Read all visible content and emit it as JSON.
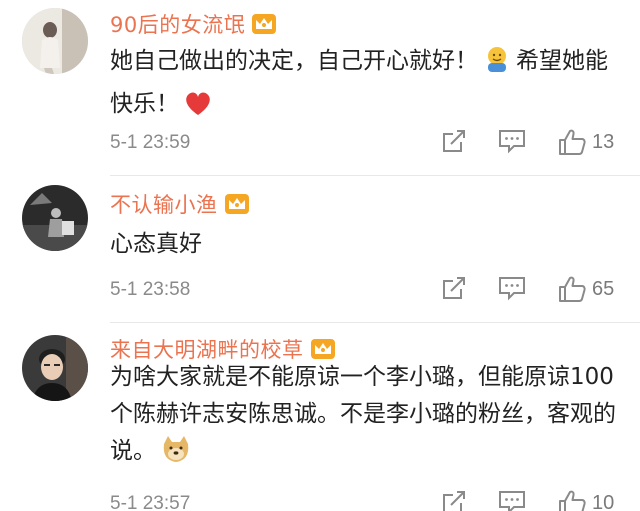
{
  "comments": [
    {
      "username": "90后的女流氓",
      "text_part1": "她自己做出的决定，自己开心就好！",
      "text_part2": "希望她能快乐！",
      "time": "5-1 23:59",
      "likes": "13",
      "emojis": [
        "hug-emoji",
        "heart-emoji"
      ]
    },
    {
      "username": "不认输小渔",
      "text": "心态真好",
      "time": "5-1 23:58",
      "likes": "65"
    },
    {
      "username": "来自大明湖畔的校草",
      "text": "为啥大家就是不能原谅一个李小璐，但能原谅100个陈赫许志安陈思诚。不是李小璐的粉丝，客观的说。",
      "time": "5-1 23:57",
      "likes": "10",
      "emojis": [
        "doge-emoji"
      ]
    }
  ],
  "colors": {
    "username": "#eb7350",
    "meta": "#8a8a8a",
    "text": "#222222",
    "crown": "#f5a623"
  },
  "icons": [
    "crown-badge-icon",
    "share-icon",
    "comment-icon",
    "like-icon"
  ]
}
